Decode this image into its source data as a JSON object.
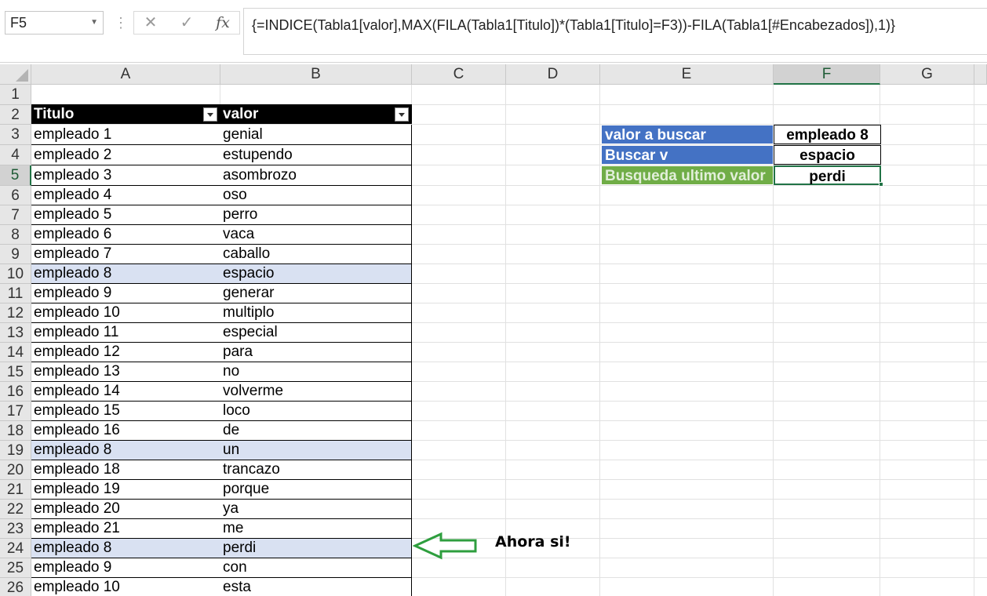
{
  "formula_bar": {
    "name_box": "F5",
    "cancel_icon": "✕",
    "enter_icon": "✓",
    "fx_icon": "fx",
    "formula": "{=INDICE(Tabla1[valor],MAX(FILA(Tabla1[Titulo])*(Tabla1[Titulo]=F3))-FILA(Tabla1[#Encabezados]),1)}"
  },
  "columns": [
    "A",
    "B",
    "C",
    "D",
    "E",
    "F",
    "G"
  ],
  "active_column": "F",
  "active_row": "5",
  "table": {
    "headers": [
      "Titulo",
      "valor"
    ],
    "rows": [
      {
        "row": "3",
        "titulo": "empleado 1",
        "valor": "genial"
      },
      {
        "row": "4",
        "titulo": "empleado 2",
        "valor": "estupendo"
      },
      {
        "row": "5",
        "titulo": "empleado 3",
        "valor": "asombrozo"
      },
      {
        "row": "6",
        "titulo": "empleado 4",
        "valor": "oso"
      },
      {
        "row": "7",
        "titulo": "empleado 5",
        "valor": "perro"
      },
      {
        "row": "8",
        "titulo": "empleado 6",
        "valor": "vaca"
      },
      {
        "row": "9",
        "titulo": "empleado 7",
        "valor": "caballo"
      },
      {
        "row": "10",
        "titulo": "empleado 8",
        "valor": "espacio",
        "highlight": true
      },
      {
        "row": "11",
        "titulo": "empleado 9",
        "valor": "generar"
      },
      {
        "row": "12",
        "titulo": "empleado 10",
        "valor": "multiplo"
      },
      {
        "row": "13",
        "titulo": "empleado 11",
        "valor": "especial"
      },
      {
        "row": "14",
        "titulo": "empleado 12",
        "valor": "para"
      },
      {
        "row": "15",
        "titulo": "empleado 13",
        "valor": "no"
      },
      {
        "row": "16",
        "titulo": "empleado 14",
        "valor": "volverme"
      },
      {
        "row": "17",
        "titulo": "empleado 15",
        "valor": "loco"
      },
      {
        "row": "18",
        "titulo": "empleado 16",
        "valor": "de"
      },
      {
        "row": "19",
        "titulo": "empleado 8",
        "valor": "un",
        "highlight": true
      },
      {
        "row": "20",
        "titulo": "empleado 18",
        "valor": "trancazo"
      },
      {
        "row": "21",
        "titulo": "empleado 19",
        "valor": "porque"
      },
      {
        "row": "22",
        "titulo": "empleado 20",
        "valor": "ya"
      },
      {
        "row": "23",
        "titulo": "empleado 21",
        "valor": "me"
      },
      {
        "row": "24",
        "titulo": "empleado 8",
        "valor": "perdi",
        "highlight": true
      },
      {
        "row": "25",
        "titulo": "empleado 9",
        "valor": "con"
      },
      {
        "row": "26",
        "titulo": "empleado 10",
        "valor": "esta"
      }
    ]
  },
  "lookup": [
    {
      "label": "valor  a buscar",
      "value": "empleado 8",
      "label_bg": "#4472c4",
      "label_color": "#ffffff"
    },
    {
      "label": "Buscar v",
      "value": "espacio",
      "label_bg": "#4472c4",
      "label_color": "#ffffff"
    },
    {
      "label": "Busqueda ultimo valor",
      "value": "perdi",
      "label_bg": "#70ad47",
      "label_color": "#e2efda"
    }
  ],
  "annotation": {
    "text": "Ahora si!",
    "arrow_icon": "left-arrow-icon",
    "arrow_color": "#2e9e3e"
  },
  "colors": {
    "highlight_row": "#d9e1f2",
    "selection": "#217346",
    "header_bg": "#000000"
  }
}
